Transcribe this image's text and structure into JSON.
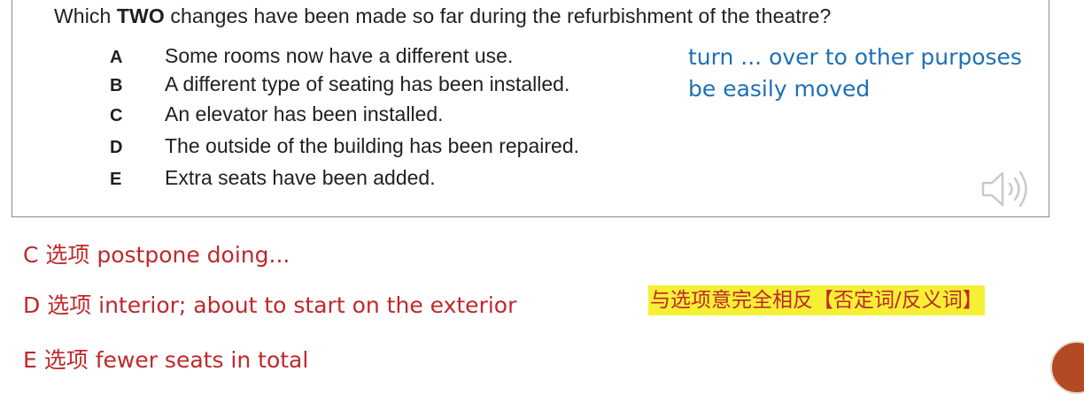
{
  "question": {
    "before": "Which ",
    "bold": "TWO",
    "after": " changes have been made so far during the refurbishment of the theatre?"
  },
  "options": [
    {
      "letter": "A",
      "text": "Some rooms now have a different use."
    },
    {
      "letter": "B",
      "text": "A different type of seating has been installed."
    },
    {
      "letter": "C",
      "text": "An elevator has been installed."
    },
    {
      "letter": "D",
      "text": "The outside of the building has been repaired."
    },
    {
      "letter": "E",
      "text": "Extra seats have been added."
    }
  ],
  "notes": {
    "a": "turn ... over to other purposes",
    "b": "be easily moved"
  },
  "annotations": {
    "c": "C 选项 postpone doing...",
    "d": "D 选项 interior; about to start on the exterior",
    "e": "E 选项  fewer seats in total",
    "highlight": "与选项意完全相反【否定词/反义词】"
  },
  "icons": {
    "audio": "speaker-icon",
    "logo": "corner-logo"
  },
  "colors": {
    "note_blue": "#1f6fb5",
    "annotation_red": "#c0282b",
    "highlight_yellow": "#f6f035"
  }
}
